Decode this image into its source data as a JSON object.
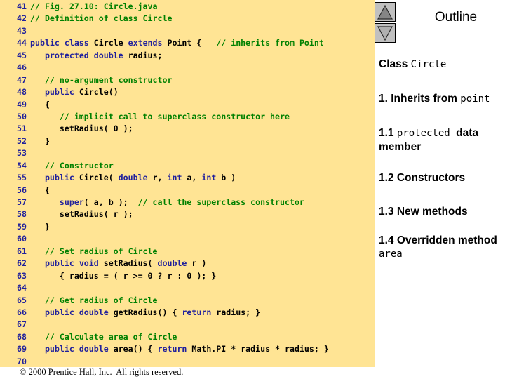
{
  "slide": {
    "code_panel": {
      "background_color": "#ffe494",
      "lines": [
        {
          "no": "41",
          "segments": [
            {
              "t": "// Fig. 27.10: Circle.java",
              "c": "cm",
              "indent": 0
            }
          ]
        },
        {
          "no": "42",
          "segments": [
            {
              "t": "// Definition of class Circle",
              "c": "cm",
              "indent": 0
            }
          ]
        },
        {
          "no": "43",
          "segments": []
        },
        {
          "no": "44",
          "segments": [
            {
              "t": "public class ",
              "c": "kw",
              "indent": 0
            },
            {
              "t": "Circle ",
              "c": "pl"
            },
            {
              "t": "extends ",
              "c": "kw"
            },
            {
              "t": "Point {   ",
              "c": "pl"
            },
            {
              "t": "// inherits from Point",
              "c": "cm"
            }
          ]
        },
        {
          "no": "45",
          "segments": [
            {
              "t": "protected double ",
              "c": "kw",
              "indent": 3
            },
            {
              "t": "radius;",
              "c": "pl"
            }
          ]
        },
        {
          "no": "46",
          "segments": []
        },
        {
          "no": "47",
          "segments": [
            {
              "t": "// no-argument constructor",
              "c": "cm",
              "indent": 3
            }
          ]
        },
        {
          "no": "48",
          "segments": [
            {
              "t": "public ",
              "c": "kw",
              "indent": 3
            },
            {
              "t": "Circle()",
              "c": "pl"
            }
          ]
        },
        {
          "no": "49",
          "segments": [
            {
              "t": "{",
              "c": "pl",
              "indent": 3
            }
          ]
        },
        {
          "no": "50",
          "segments": [
            {
              "t": "// implicit call to superclass constructor here",
              "c": "cm",
              "indent": 6
            }
          ]
        },
        {
          "no": "51",
          "segments": [
            {
              "t": "setRadius( 0 );",
              "c": "pl",
              "indent": 6
            }
          ]
        },
        {
          "no": "52",
          "segments": [
            {
              "t": "}",
              "c": "pl",
              "indent": 3
            }
          ]
        },
        {
          "no": "53",
          "segments": []
        },
        {
          "no": "54",
          "segments": [
            {
              "t": "// Constructor",
              "c": "cm",
              "indent": 3
            }
          ]
        },
        {
          "no": "55",
          "segments": [
            {
              "t": "public ",
              "c": "kw",
              "indent": 3
            },
            {
              "t": "Circle( ",
              "c": "pl"
            },
            {
              "t": "double ",
              "c": "kw"
            },
            {
              "t": "r, ",
              "c": "pl"
            },
            {
              "t": "int ",
              "c": "kw"
            },
            {
              "t": "a, ",
              "c": "pl"
            },
            {
              "t": "int ",
              "c": "kw"
            },
            {
              "t": "b )",
              "c": "pl"
            }
          ]
        },
        {
          "no": "56",
          "segments": [
            {
              "t": "{",
              "c": "pl",
              "indent": 3
            }
          ]
        },
        {
          "no": "57",
          "segments": [
            {
              "t": "super",
              "c": "kw",
              "indent": 6
            },
            {
              "t": "( a, b );  ",
              "c": "pl"
            },
            {
              "t": "// call the superclass constructor",
              "c": "cm"
            }
          ]
        },
        {
          "no": "58",
          "segments": [
            {
              "t": "setRadius( r );",
              "c": "pl",
              "indent": 6
            }
          ]
        },
        {
          "no": "59",
          "segments": [
            {
              "t": "}",
              "c": "pl",
              "indent": 3
            }
          ]
        },
        {
          "no": "60",
          "segments": []
        },
        {
          "no": "61",
          "segments": [
            {
              "t": "// Set radius of Circle",
              "c": "cm",
              "indent": 3
            }
          ]
        },
        {
          "no": "62",
          "segments": [
            {
              "t": "public void ",
              "c": "kw",
              "indent": 3
            },
            {
              "t": "setRadius( ",
              "c": "pl"
            },
            {
              "t": "double ",
              "c": "kw"
            },
            {
              "t": "r )",
              "c": "pl"
            }
          ]
        },
        {
          "no": "63",
          "segments": [
            {
              "t": "{ radius = ( r >= 0 ? r : 0 ); }",
              "c": "pl",
              "indent": 6
            }
          ]
        },
        {
          "no": "64",
          "segments": []
        },
        {
          "no": "65",
          "segments": [
            {
              "t": "// Get radius of Circle",
              "c": "cm",
              "indent": 3
            }
          ]
        },
        {
          "no": "66",
          "segments": [
            {
              "t": "public double ",
              "c": "kw",
              "indent": 3
            },
            {
              "t": "getRadius() { ",
              "c": "pl"
            },
            {
              "t": "return ",
              "c": "kw"
            },
            {
              "t": "radius; }",
              "c": "pl"
            }
          ]
        },
        {
          "no": "67",
          "segments": []
        },
        {
          "no": "68",
          "segments": [
            {
              "t": "// Calculate area of Circle",
              "c": "cm",
              "indent": 3
            }
          ]
        },
        {
          "no": "69",
          "segments": [
            {
              "t": "public double ",
              "c": "kw",
              "indent": 3
            },
            {
              "t": "area() { ",
              "c": "pl"
            },
            {
              "t": "return ",
              "c": "kw"
            },
            {
              "t": "Math.PI * radius * radius; }",
              "c": "pl"
            }
          ]
        },
        {
          "no": "70",
          "segments": []
        }
      ]
    },
    "footer": {
      "text": "© 2000 Prentice Hall, Inc.  All rights reserved."
    },
    "outline": {
      "title": "Outline",
      "scroll_up_label": "up-triangle",
      "scroll_down_label": "down-triangle",
      "items": [
        {
          "parts": [
            {
              "t": "Class ",
              "m": false
            },
            {
              "t": "Circle",
              "m": true
            }
          ]
        },
        {
          "parts": [
            {
              "t": "1. Inherits from ",
              "m": false
            },
            {
              "t": "point",
              "m": true
            }
          ]
        },
        {
          "parts": [
            {
              "t": "1.1 ",
              "m": false
            },
            {
              "t": "protected ",
              "m": true
            },
            {
              "t": "data member",
              "m": false
            }
          ]
        },
        {
          "parts": [
            {
              "t": "1.2 Constructors",
              "m": false
            }
          ]
        },
        {
          "parts": [
            {
              "t": "1.3 New methods",
              "m": false
            }
          ]
        },
        {
          "parts": [
            {
              "t": "1.4 Overridden method ",
              "m": false
            },
            {
              "t": "area",
              "m": true
            }
          ]
        }
      ]
    }
  }
}
